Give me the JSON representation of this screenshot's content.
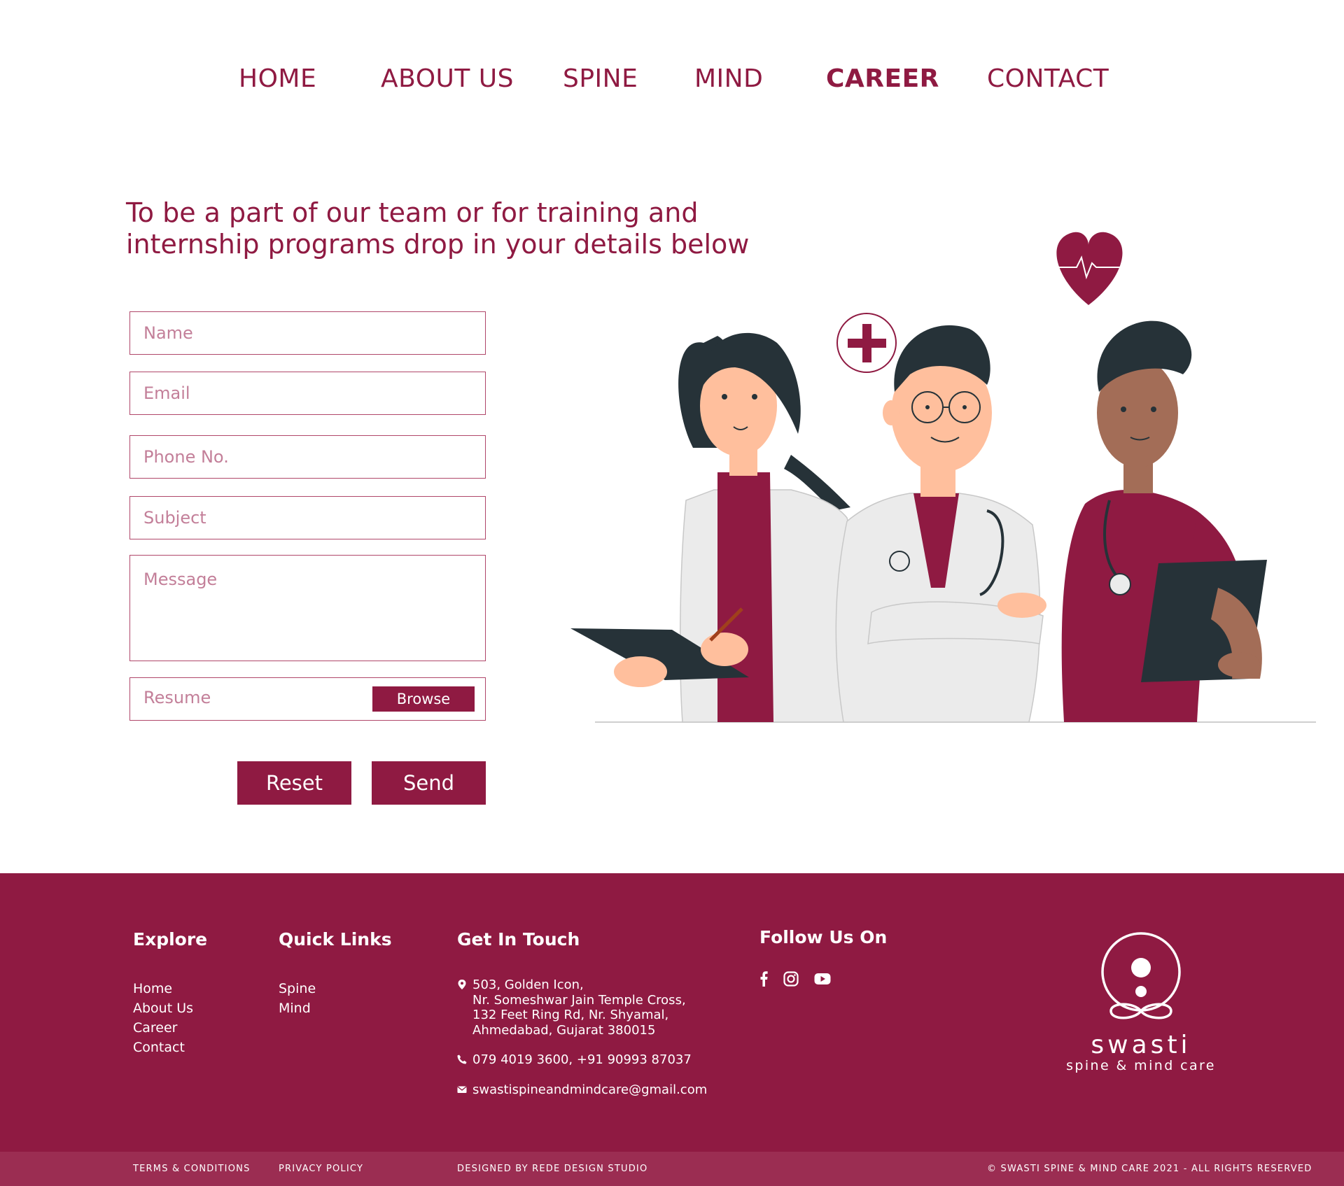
{
  "nav": {
    "items": [
      {
        "label": "HOME"
      },
      {
        "label": "ABOUT US"
      },
      {
        "label": "SPINE"
      },
      {
        "label": "MIND"
      },
      {
        "label": "CAREER"
      },
      {
        "label": "CONTACT"
      }
    ],
    "active": "CAREER"
  },
  "headline": {
    "line1": "To be a part of our team or for training and",
    "line2": "internship programs drop in your details below"
  },
  "form": {
    "name_placeholder": "Name",
    "email_placeholder": "Email",
    "phone_placeholder": "Phone No.",
    "subject_placeholder": "Subject",
    "message_placeholder": "Message",
    "resume_label": "Resume",
    "browse_label": "Browse",
    "reset_label": "Reset",
    "send_label": "Send"
  },
  "footer": {
    "explore": {
      "heading": "Explore",
      "links": [
        "Home",
        "About Us",
        "Career",
        "Contact"
      ]
    },
    "quick_links": {
      "heading": "Quick Links",
      "links": [
        "Spine",
        "Mind"
      ]
    },
    "get_in_touch": {
      "heading": "Get In Touch",
      "address_lines": [
        "503, Golden Icon,",
        "Nr. Someshwar Jain Temple Cross,",
        "132 Feet Ring Rd, Nr. Shyamal,",
        "Ahmedabad, Gujarat 380015"
      ],
      "phone": "079 4019 3600, +91 90993 87037",
      "email": "swastispineandmindcare@gmail.com"
    },
    "follow": {
      "heading": "Follow Us On",
      "icons": [
        "facebook-icon",
        "instagram-icon",
        "youtube-icon"
      ]
    },
    "logo": {
      "word": "swasti",
      "tagline": "spine & mind care"
    }
  },
  "bottom_bar": {
    "terms": "TERMS & CONDITIONS",
    "privacy": "PRIVACY POLICY",
    "designed_by": "DESIGNED BY REDE DESIGN STUDIO",
    "copyright": "© SWASTI SPINE & MIND CARE 2021 - ALL RIGHTS RESERVED"
  },
  "colors": {
    "brand": "#8f1a42",
    "bottom_bar": "#9b2d52",
    "placeholder": "#c37f99"
  }
}
